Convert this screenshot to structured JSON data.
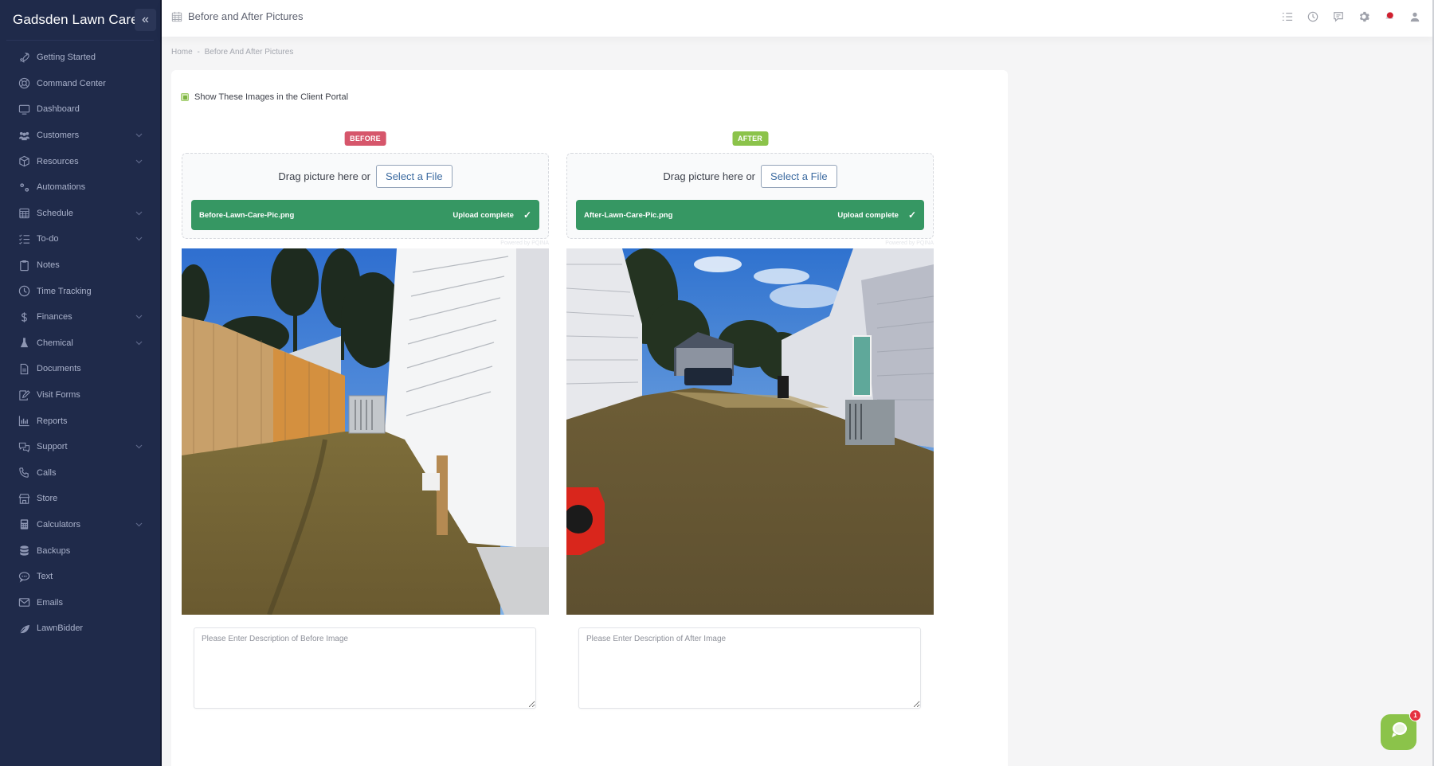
{
  "sidebar": {
    "brand": "Gadsden Lawn Care",
    "collapse_icon": "double-chevron-left",
    "items": [
      {
        "label": "Getting Started",
        "icon": "rocket",
        "expandable": false
      },
      {
        "label": "Command Center",
        "icon": "lifebuoy",
        "expandable": false
      },
      {
        "label": "Dashboard",
        "icon": "monitor",
        "expandable": false
      },
      {
        "label": "Customers",
        "icon": "users",
        "expandable": true
      },
      {
        "label": "Resources",
        "icon": "box",
        "expandable": true
      },
      {
        "label": "Automations",
        "icon": "gears",
        "expandable": false
      },
      {
        "label": "Schedule",
        "icon": "calendar",
        "expandable": true
      },
      {
        "label": "To-do",
        "icon": "checklist",
        "expandable": true
      },
      {
        "label": "Notes",
        "icon": "clipboard",
        "expandable": false
      },
      {
        "label": "Time Tracking",
        "icon": "clock",
        "expandable": false
      },
      {
        "label": "Finances",
        "icon": "dollar",
        "expandable": true
      },
      {
        "label": "Chemical",
        "icon": "flask",
        "expandable": true
      },
      {
        "label": "Documents",
        "icon": "document",
        "expandable": false
      },
      {
        "label": "Visit Forms",
        "icon": "form-edit",
        "expandable": false
      },
      {
        "label": "Reports",
        "icon": "bar-chart",
        "expandable": false
      },
      {
        "label": "Support",
        "icon": "chat-bubbles",
        "expandable": true
      },
      {
        "label": "Calls",
        "icon": "phone",
        "expandable": false
      },
      {
        "label": "Store",
        "icon": "store",
        "expandable": false
      },
      {
        "label": "Calculators",
        "icon": "calculator",
        "expandable": true
      },
      {
        "label": "Backups",
        "icon": "database",
        "expandable": false
      },
      {
        "label": "Text",
        "icon": "sms",
        "expandable": false
      },
      {
        "label": "Emails",
        "icon": "envelope",
        "expandable": false
      },
      {
        "label": "LawnBidder",
        "icon": "leaf",
        "expandable": false
      }
    ]
  },
  "header": {
    "title": "Before and After Pictures",
    "title_icon": "calendar-grid",
    "icons": [
      "list-settings",
      "clock",
      "message",
      "gear",
      "notification-bell",
      "user"
    ],
    "notification_color": "#d0202f"
  },
  "breadcrumb": {
    "items": [
      "Home",
      "-",
      "Before And After Pictures"
    ]
  },
  "main": {
    "portal_checkbox": {
      "label": "Show These Images in the Client Portal",
      "checked": true
    },
    "before": {
      "tag": "BEFORE",
      "tag_color": "#d6566b",
      "drag_text": "Drag picture here or",
      "select_label": "Select a File",
      "file_name": "Before-Lawn-Care-Pic.png",
      "status": "Upload complete",
      "powered_by": "Powered by PQINA",
      "description_placeholder": "Please Enter Description of Before Image",
      "description_value": ""
    },
    "after": {
      "tag": "AFTER",
      "tag_color": "#8bc34a",
      "drag_text": "Drag picture here or",
      "select_label": "Select a File",
      "file_name": "After-Lawn-Care-Pic.png",
      "status": "Upload complete",
      "powered_by": "Powered by PQINA",
      "description_placeholder": "Please Enter Description of After Image",
      "description_value": ""
    },
    "upload_color": "#369763"
  },
  "chat": {
    "badge_count": "1",
    "color": "#8bc34a"
  }
}
